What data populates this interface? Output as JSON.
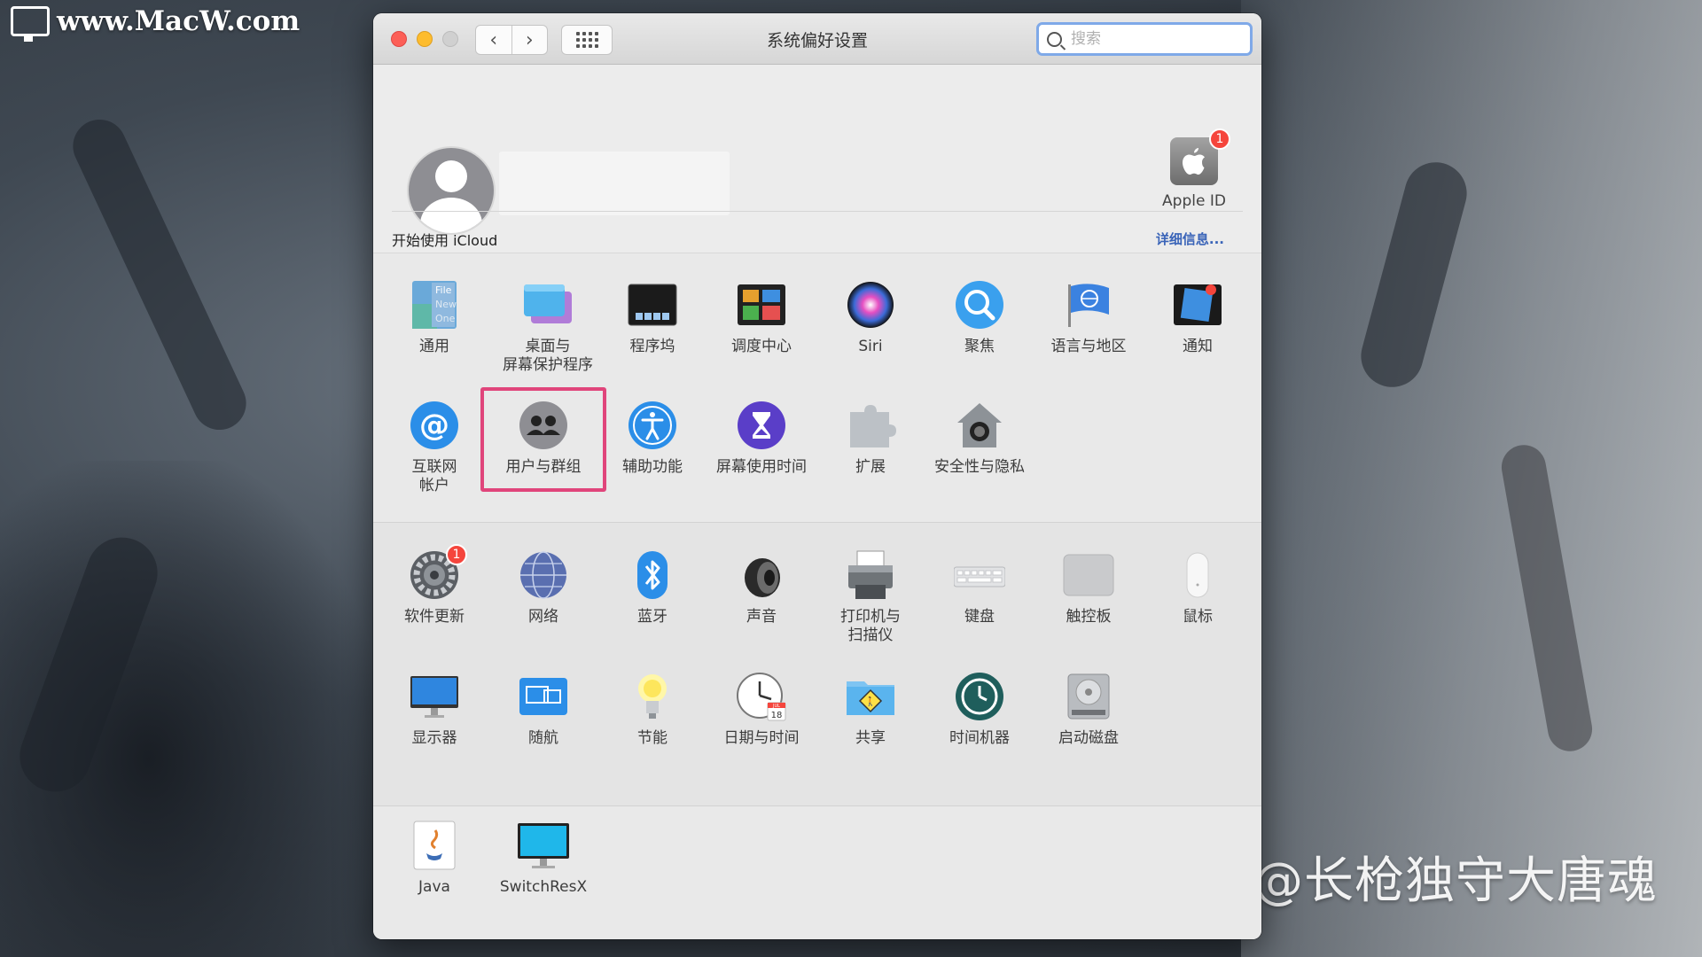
{
  "watermarks": {
    "top_left": "www.MacW.com",
    "bottom_right": "知乎 @长枪独守大唐魂"
  },
  "window": {
    "title": "系统偏好设置",
    "search_placeholder": "搜索"
  },
  "account": {
    "apple_id_label": "Apple ID",
    "apple_id_badge": "1",
    "icloud_prompt": "开始使用 iCloud",
    "details_link": "详细信息..."
  },
  "section1": [
    {
      "name": "general",
      "label": "通用",
      "icon": "general-icon"
    },
    {
      "name": "desktop",
      "label": "桌面与\n屏幕保护程序",
      "icon": "desktop-screensaver-icon"
    },
    {
      "name": "dock",
      "label": "程序坞",
      "icon": "dock-icon"
    },
    {
      "name": "mission-control",
      "label": "调度中心",
      "icon": "mission-control-icon"
    },
    {
      "name": "siri",
      "label": "Siri",
      "icon": "siri-icon"
    },
    {
      "name": "spotlight",
      "label": "聚焦",
      "icon": "spotlight-icon"
    },
    {
      "name": "language-region",
      "label": "语言与地区",
      "icon": "globe-flag-icon"
    },
    {
      "name": "notifications",
      "label": "通知",
      "icon": "notifications-icon"
    },
    {
      "name": "internet-accounts",
      "label": "互联网\n帐户",
      "icon": "at-sign-icon"
    },
    {
      "name": "users-groups",
      "label": "用户与群组",
      "icon": "users-icon"
    },
    {
      "name": "accessibility",
      "label": "辅助功能",
      "icon": "accessibility-icon"
    },
    {
      "name": "screen-time",
      "label": "屏幕使用时间",
      "icon": "hourglass-icon"
    },
    {
      "name": "extensions",
      "label": "扩展",
      "icon": "puzzle-icon"
    },
    {
      "name": "security-privacy",
      "label": "安全性与隐私",
      "icon": "house-lock-icon"
    }
  ],
  "section2": [
    {
      "name": "software-update",
      "label": "软件更新",
      "icon": "gear-icon",
      "badge": "1"
    },
    {
      "name": "network",
      "label": "网络",
      "icon": "network-globe-icon"
    },
    {
      "name": "bluetooth",
      "label": "蓝牙",
      "icon": "bluetooth-icon"
    },
    {
      "name": "sound",
      "label": "声音",
      "icon": "speaker-icon"
    },
    {
      "name": "printers-scanners",
      "label": "打印机与\n扫描仪",
      "icon": "printer-icon"
    },
    {
      "name": "keyboard",
      "label": "键盘",
      "icon": "keyboard-icon"
    },
    {
      "name": "trackpad",
      "label": "触控板",
      "icon": "trackpad-icon"
    },
    {
      "name": "mouse",
      "label": "鼠标",
      "icon": "mouse-icon"
    },
    {
      "name": "displays",
      "label": "显示器",
      "icon": "display-icon"
    },
    {
      "name": "sidecar",
      "label": "随航",
      "icon": "sidecar-icon"
    },
    {
      "name": "energy-saver",
      "label": "节能",
      "icon": "lightbulb-icon"
    },
    {
      "name": "date-time",
      "label": "日期与时间",
      "icon": "clock-calendar-icon",
      "cal_month": "JUL",
      "cal_day": "18"
    },
    {
      "name": "sharing",
      "label": "共享",
      "icon": "sharing-folder-icon"
    },
    {
      "name": "time-machine",
      "label": "时间机器",
      "icon": "time-machine-icon"
    },
    {
      "name": "startup-disk",
      "label": "启动磁盘",
      "icon": "hard-disk-icon"
    }
  ],
  "section3": [
    {
      "name": "java",
      "label": "Java",
      "icon": "java-icon"
    },
    {
      "name": "switchresx",
      "label": "SwitchResX",
      "icon": "switchresx-monitor-icon"
    }
  ],
  "general_icon_text": [
    "File",
    "New",
    "One"
  ]
}
